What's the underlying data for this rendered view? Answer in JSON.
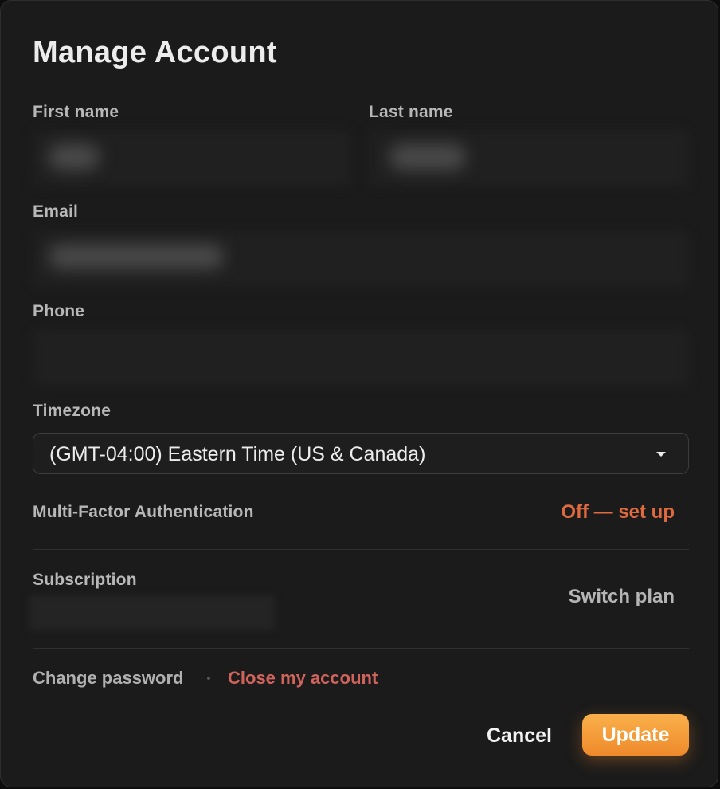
{
  "dialog": {
    "title": "Manage Account"
  },
  "fields": {
    "first_name_label": "First name",
    "last_name_label": "Last name",
    "email_label": "Email",
    "phone_label": "Phone",
    "timezone_label": "Timezone",
    "timezone_value": "(GMT-04:00) Eastern Time (US & Canada)"
  },
  "mfa": {
    "label": "Multi-Factor Authentication",
    "action": "Off — set up"
  },
  "subscription": {
    "label": "Subscription",
    "action": "Switch plan"
  },
  "footer": {
    "change_password": "Change password",
    "close_account": "Close my account"
  },
  "buttons": {
    "cancel": "Cancel",
    "update": "Update"
  },
  "colors": {
    "accent": "#e06a40",
    "danger_link": "#d0645c",
    "update_button": "#f5a03a"
  }
}
